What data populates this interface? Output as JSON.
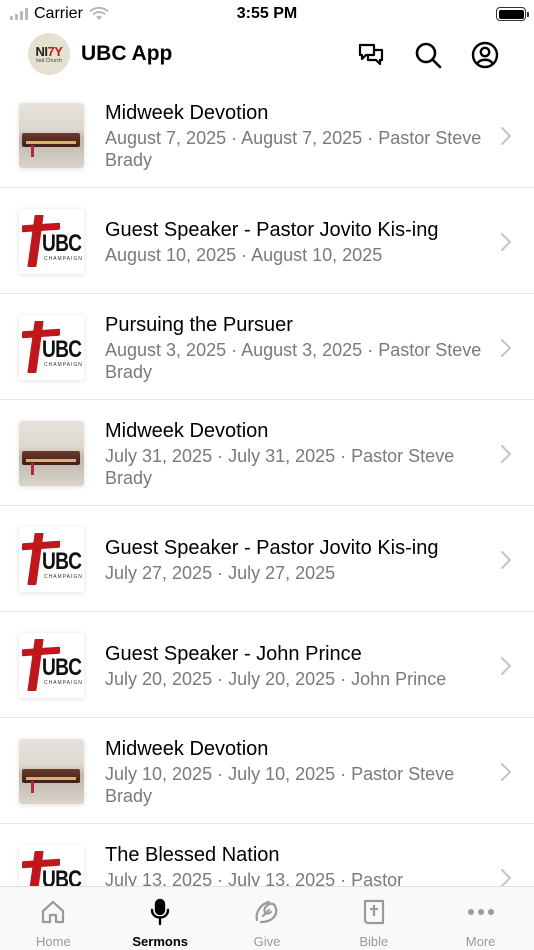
{
  "status_bar": {
    "carrier": "Carrier",
    "time": "3:55 PM"
  },
  "header": {
    "logo_text_a": "NI",
    "logo_text_b": "7Y",
    "logo_sub": "ited Church",
    "title": "UBC App",
    "icons": [
      "chat-icon",
      "search-icon",
      "account-icon"
    ]
  },
  "sermons": [
    {
      "title": "Midweek Devotion",
      "subtitle": "August 7, 2025 · August 7, 2025 · Pastor Steve Brady",
      "thumb": "bible"
    },
    {
      "title": "Guest Speaker - Pastor Jovito Kis-ing",
      "subtitle": "August 10, 2025 · August 10, 2025",
      "thumb": "ubc"
    },
    {
      "title": "Pursuing the Pursuer",
      "subtitle": "August 3, 2025 · August 3, 2025 · Pastor Steve Brady",
      "thumb": "ubc"
    },
    {
      "title": "Midweek Devotion",
      "subtitle": "July 31, 2025 · July 31, 2025 · Pastor Steve Brady",
      "thumb": "bible"
    },
    {
      "title": "Guest Speaker - Pastor Jovito Kis-ing",
      "subtitle": "July 27, 2025 · July 27, 2025",
      "thumb": "ubc"
    },
    {
      "title": "Guest Speaker - John Prince",
      "subtitle": "July 20, 2025 · July 20, 2025 · John Prince",
      "thumb": "ubc"
    },
    {
      "title": "Midweek Devotion",
      "subtitle": "July 10, 2025 · July 10, 2025 · Pastor Steve Brady",
      "thumb": "bible"
    },
    {
      "title": "The Blessed Nation",
      "subtitle": "July 13, 2025 · July 13, 2025 · Pastor",
      "thumb": "ubc"
    }
  ],
  "ubc_logo": {
    "text": "UBC",
    "sub": "CHAMPAIGN"
  },
  "tabs": [
    {
      "label": "Home",
      "icon": "home-icon"
    },
    {
      "label": "Sermons",
      "icon": "microphone-icon",
      "active": true
    },
    {
      "label": "Give",
      "icon": "give-icon"
    },
    {
      "label": "Bible",
      "icon": "bible-icon"
    },
    {
      "label": "More",
      "icon": "more-icon"
    }
  ],
  "colors": {
    "accent": "#c0171c",
    "secondary_text": "#7a7a7a",
    "inactive_tab": "#9a9a9a"
  }
}
